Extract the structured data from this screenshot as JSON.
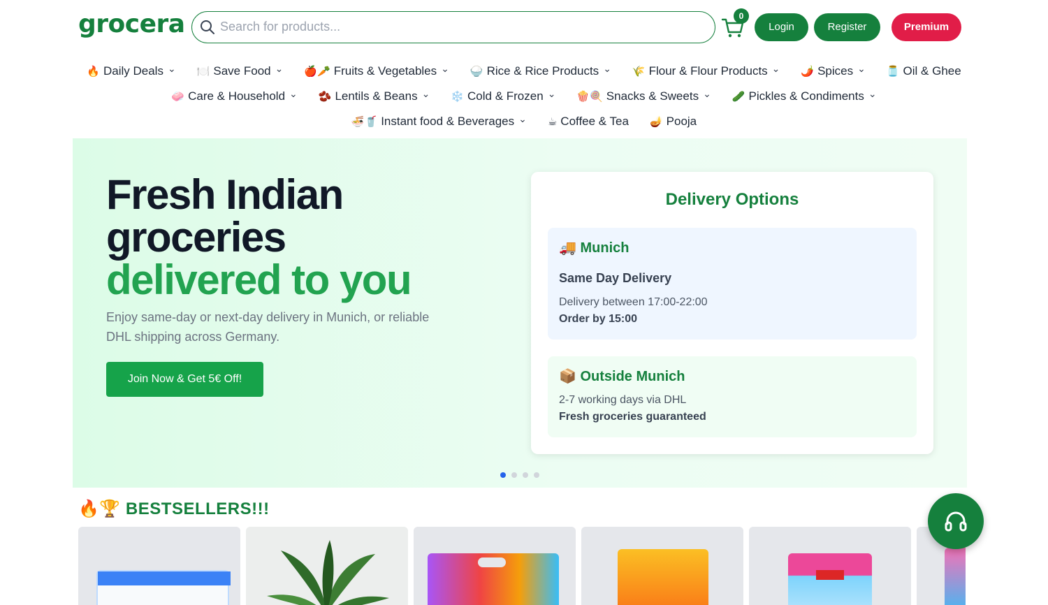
{
  "header": {
    "logo_text": "grocera",
    "search_placeholder": "Search for products...",
    "cart_count": "0",
    "login_label": "Login",
    "register_label": "Register",
    "premium_label": "Premium"
  },
  "nav": {
    "row1": [
      {
        "icon": "🔥",
        "label": "Daily Deals",
        "dropdown": true
      },
      {
        "icon": "🍽️",
        "label": "Save Food",
        "dropdown": true
      },
      {
        "icon": "🍎🥕",
        "label": "Fruits & Vegetables",
        "dropdown": true
      },
      {
        "icon": "🍚",
        "label": "Rice & Rice Products",
        "dropdown": true
      },
      {
        "icon": "🌾",
        "label": "Flour & Flour Products",
        "dropdown": true
      },
      {
        "icon": "🌶️",
        "label": "Spices",
        "dropdown": true
      },
      {
        "icon": "🫙",
        "label": "Oil & Ghee",
        "dropdown": false
      }
    ],
    "row2": [
      {
        "icon": "🧼",
        "label": "Care & Household",
        "dropdown": true
      },
      {
        "icon": "🫘",
        "label": "Lentils & Beans",
        "dropdown": true
      },
      {
        "icon": "❄️",
        "label": "Cold & Frozen",
        "dropdown": true
      },
      {
        "icon": "🍿🍭",
        "label": "Snacks & Sweets",
        "dropdown": true
      },
      {
        "icon": "🥒",
        "label": "Pickles & Condiments",
        "dropdown": true
      }
    ],
    "row3": [
      {
        "icon": "🍜🥤",
        "label": "Instant food & Beverages",
        "dropdown": true
      },
      {
        "icon": "☕",
        "label": "Coffee & Tea",
        "dropdown": false
      },
      {
        "icon": "🪔",
        "label": "Pooja",
        "dropdown": false
      }
    ]
  },
  "hero": {
    "title_line1": "Fresh Indian",
    "title_line2": "groceries",
    "title_line3": "delivered to you",
    "subtitle": "Enjoy same-day or next-day delivery in Munich, or reliable DHL shipping across Germany.",
    "cta_label": "Join Now & Get 5€ Off!",
    "slides_total": 4,
    "active_slide": 1
  },
  "delivery": {
    "title": "Delivery Options",
    "munich": {
      "icon": "🚚",
      "heading": "Munich",
      "subheading": "Same Day Delivery",
      "line1": "Delivery between 17:00-22:00",
      "line2": "Order by 15:00"
    },
    "outside": {
      "icon": "📦",
      "heading": "Outside Munich",
      "line1": "2-7 working days via DHL",
      "line2": "Fresh groceries guaranteed"
    }
  },
  "bestsellers": {
    "title": "🔥🏆 BESTSELLERS!!!"
  },
  "colors": {
    "brand_green": "#15803d",
    "cta_green": "#16a34a",
    "premium_red": "#e11d48",
    "hero_bg": "#dcfce7"
  }
}
